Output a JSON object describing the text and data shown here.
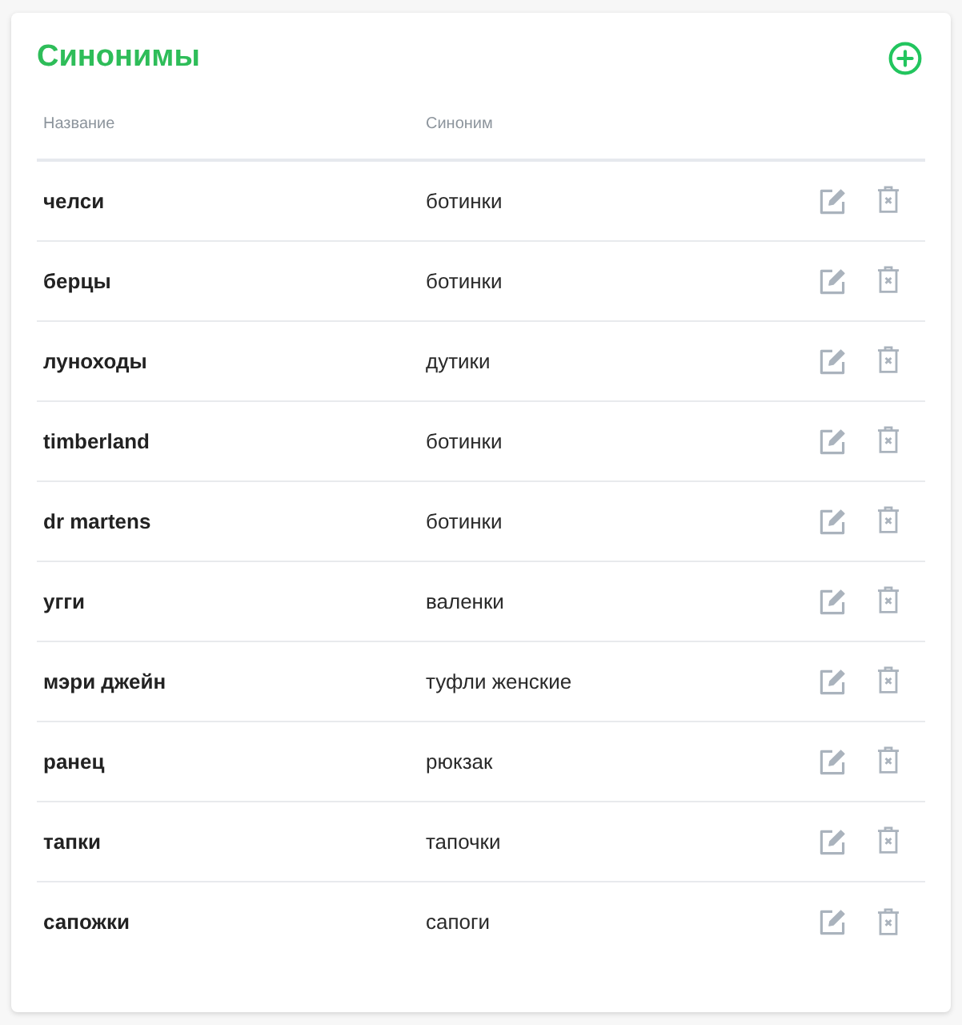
{
  "card": {
    "title": "Синонимы"
  },
  "table": {
    "columns": [
      "Название",
      "Синоним"
    ],
    "rows": [
      {
        "name": "челси",
        "synonym": "ботинки"
      },
      {
        "name": "берцы",
        "synonym": "ботинки"
      },
      {
        "name": "луноходы",
        "synonym": "дутики"
      },
      {
        "name": "timberland",
        "synonym": "ботинки"
      },
      {
        "name": "dr martens",
        "synonym": "ботинки"
      },
      {
        "name": "угги",
        "synonym": "валенки"
      },
      {
        "name": "мэри джейн",
        "synonym": "туфли женские"
      },
      {
        "name": "ранец",
        "synonym": "рюкзак"
      },
      {
        "name": "тапки",
        "synonym": "тапочки"
      },
      {
        "name": "сапожки",
        "synonym": "сапоги"
      }
    ]
  }
}
